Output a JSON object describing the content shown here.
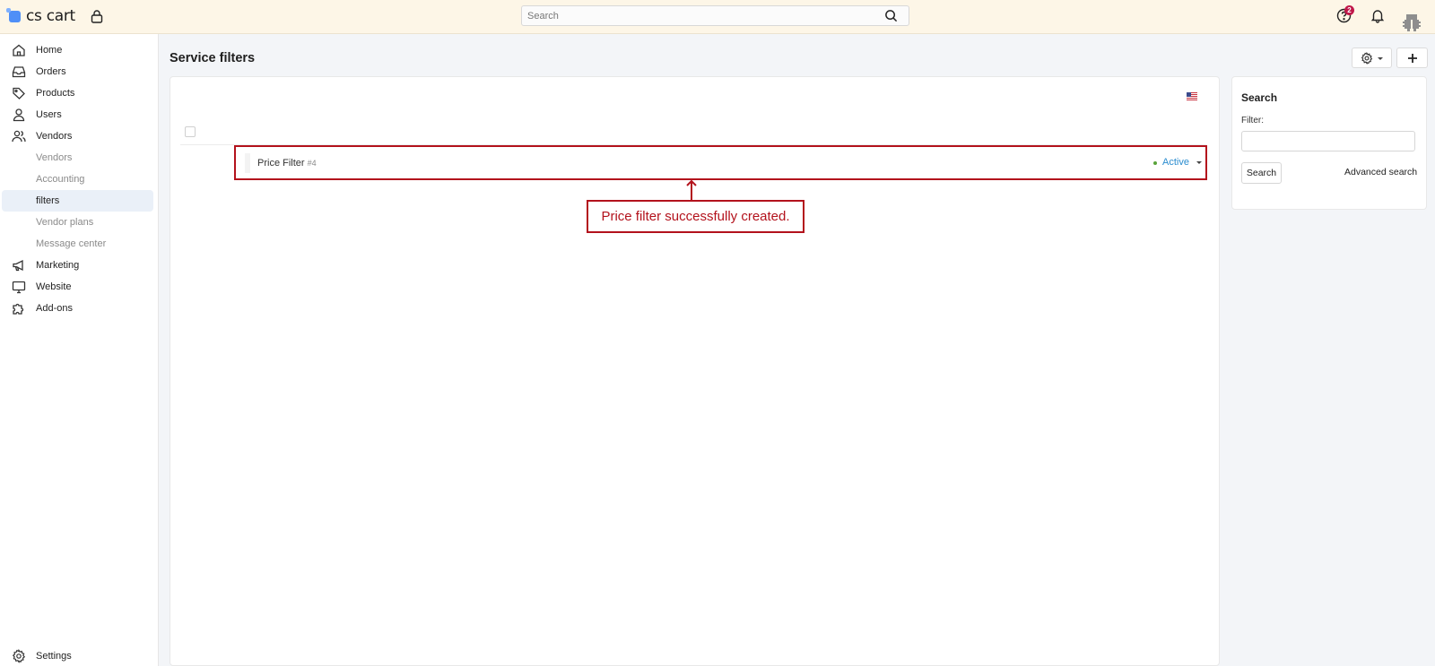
{
  "brand": {
    "name": "cs cart"
  },
  "topbar": {
    "search_placeholder": "Search",
    "notifications_count": "2"
  },
  "sidebar": {
    "items": [
      {
        "label": "Home",
        "icon": "home-icon"
      },
      {
        "label": "Orders",
        "icon": "inbox-icon"
      },
      {
        "label": "Products",
        "icon": "tag-icon"
      },
      {
        "label": "Users",
        "icon": "user-icon"
      },
      {
        "label": "Vendors",
        "icon": "users-icon"
      },
      {
        "label": "Vendors"
      },
      {
        "label": "Accounting"
      },
      {
        "label": "filters",
        "active": true
      },
      {
        "label": "Vendor plans"
      },
      {
        "label": "Message center"
      },
      {
        "label": "Marketing",
        "icon": "megaphone-icon"
      },
      {
        "label": "Website",
        "icon": "monitor-icon"
      },
      {
        "label": "Add-ons",
        "icon": "puzzle-icon"
      }
    ],
    "settings_label": "Settings"
  },
  "main": {
    "title": "Service filters",
    "filters": [
      {
        "name": "Price Filter",
        "id": "#4",
        "status": "Active"
      }
    ],
    "annotation": "Price filter successfully created."
  },
  "search_panel": {
    "title": "Search",
    "filter_label": "Filter:",
    "filter_value": "",
    "search_button": "Search",
    "advanced_link": "Advanced search"
  },
  "colors": {
    "topbar_bg": "#fdf6e7",
    "accent_red": "#b3121c",
    "status_link": "#2a8ccf",
    "badge": "#c0184a"
  }
}
